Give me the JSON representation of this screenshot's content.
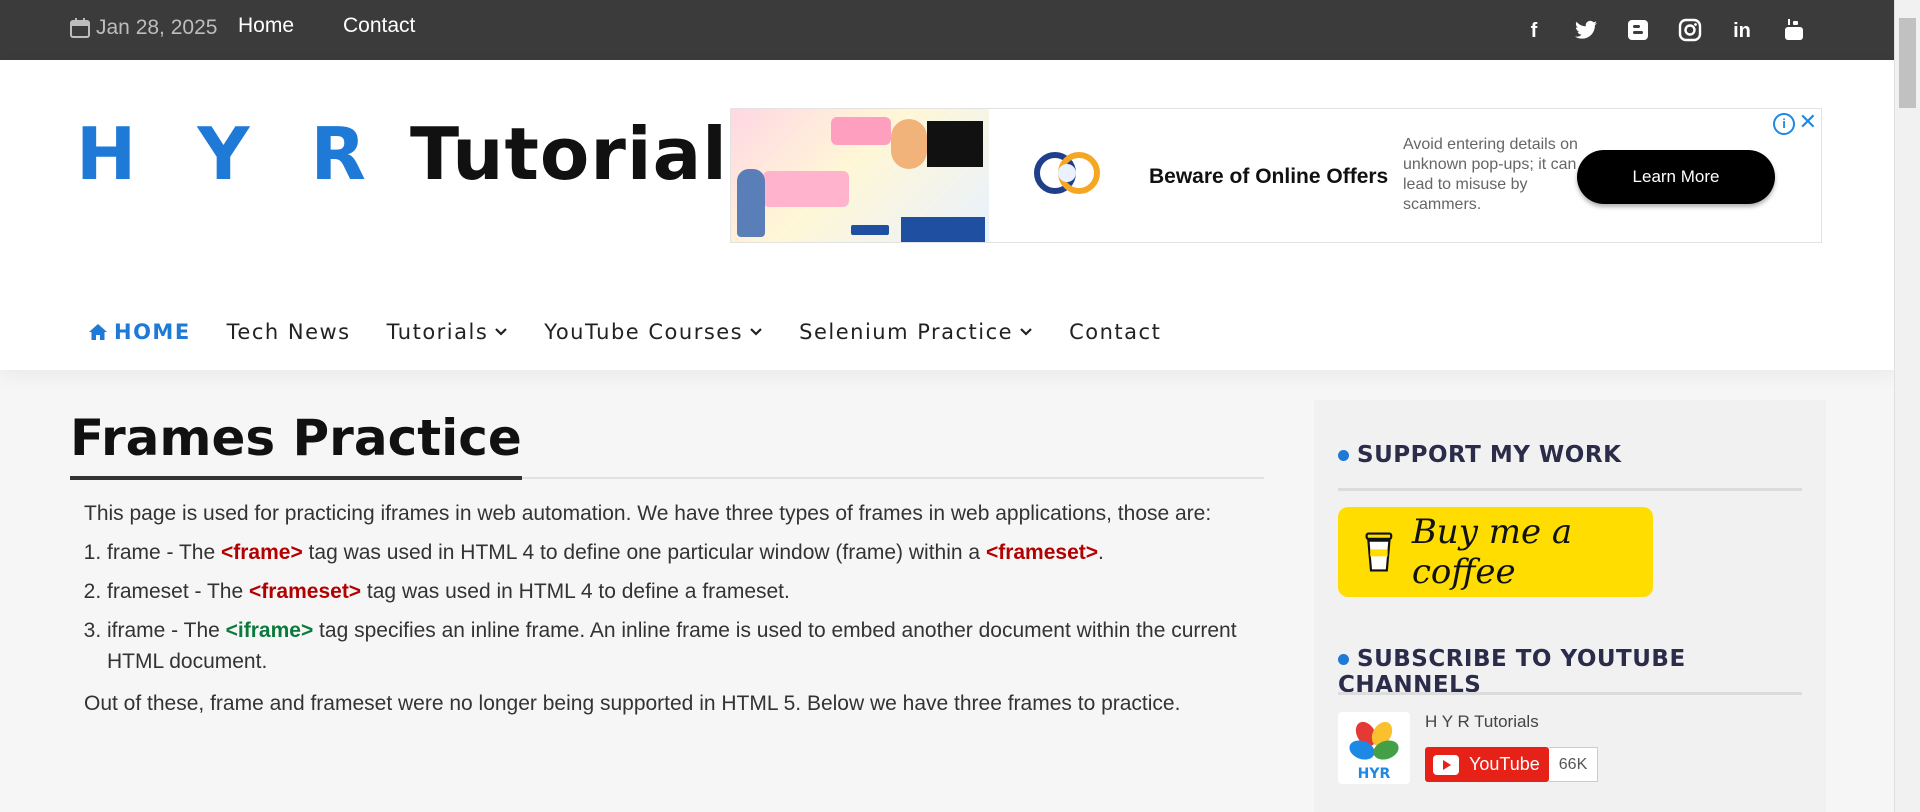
{
  "topbar": {
    "date": "Jan 28, 2025",
    "links": [
      "Home",
      "Contact"
    ],
    "social_icons": [
      "facebook-icon",
      "twitter-icon",
      "blogger-icon",
      "instagram-icon",
      "linkedin-icon",
      "youtube-icon"
    ]
  },
  "logo": {
    "part1": "H Y R",
    "part2": "Tutorials"
  },
  "ad": {
    "headline": "Beware of Online Offers",
    "description": "Avoid entering details on unknown pop-ups; it can lead to misuse by scammers.",
    "cta": "Learn More",
    "info": "i",
    "close": "✕"
  },
  "nav": {
    "items": [
      {
        "label": "HOME"
      },
      {
        "label": "Tech News"
      },
      {
        "label": "Tutorials"
      },
      {
        "label": "YouTube Courses"
      },
      {
        "label": "Selenium Practice"
      },
      {
        "label": "Contact"
      }
    ]
  },
  "main": {
    "title": "Frames Practice",
    "intro": "This page is used for practicing iframes in web automation. We have three types of frames in web applications, those are:",
    "items": [
      {
        "pre": "frame - The ",
        "tag": "<frame>",
        "mid": " tag was used in HTML 4 to define one particular window (frame) within a ",
        "tag2": "<frameset>",
        "post": "."
      },
      {
        "pre": "frameset - The ",
        "tag": "<frameset>",
        "post": " tag was used in HTML 4 to define a frameset."
      },
      {
        "pre": "iframe - The ",
        "tag": "<iframe>",
        "post": " tag specifies an inline frame. An inline frame is used to embed another document within the current HTML document."
      }
    ],
    "outro": "Out of these, frame and frameset were no longer being supported in HTML 5. Below we have three frames to practice."
  },
  "sidebar": {
    "support_title": "SUPPORT MY WORK",
    "bmc_label": "Buy me a coffee",
    "subscribe_title": "SUBSCRIBE TO YOUTUBE CHANNELS",
    "channel_name": "H Y R Tutorials",
    "youtube_label": "YouTube",
    "subscriber_count": "66K"
  },
  "colors": {
    "accent": "#1e7ad6",
    "topbar": "#3b3b3b",
    "tag_red": "#b30000",
    "tag_green": "#0b7a3b",
    "bmc_yellow": "#ffdd00",
    "youtube_red": "#e62117"
  }
}
